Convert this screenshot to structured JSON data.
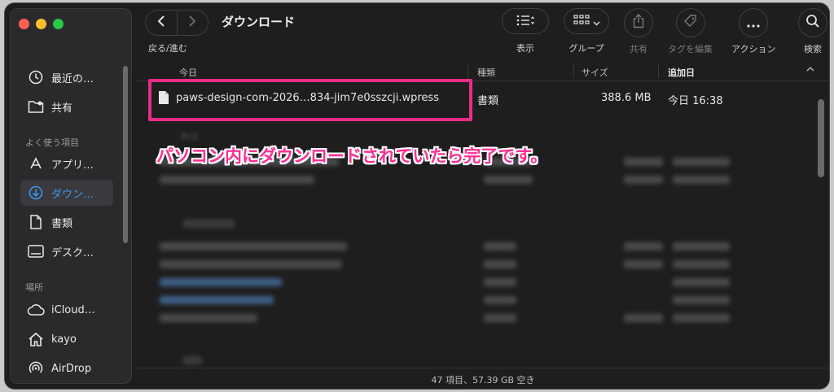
{
  "window": {
    "title": "ダウンロード"
  },
  "toolbar": {
    "nav_label": "戻る/進む",
    "view_label": "表示",
    "group_label": "グループ",
    "share_label": "共有",
    "tag_label": "タグを編集",
    "action_label": "アクション",
    "search_label": "検索"
  },
  "sidebar": {
    "items_top": [
      {
        "label": "最近の…",
        "icon": "clock-icon"
      },
      {
        "label": "共有",
        "icon": "shared-folder-icon"
      }
    ],
    "favorites_header": "よく使う項目",
    "favorites": [
      {
        "label": "アプリ…",
        "icon": "applications-icon"
      },
      {
        "label": "ダウン…",
        "icon": "downloads-icon"
      },
      {
        "label": "書類",
        "icon": "document-icon"
      },
      {
        "label": "デスク…",
        "icon": "desktop-icon"
      }
    ],
    "locations_header": "場所",
    "locations": [
      {
        "label": "iCloud…",
        "icon": "cloud-icon"
      },
      {
        "label": "kayo",
        "icon": "home-icon"
      },
      {
        "label": "AirDrop",
        "icon": "airdrop-icon"
      }
    ]
  },
  "columns": {
    "name": "今日",
    "kind": "種類",
    "size": "サイズ",
    "date": "追加日"
  },
  "file": {
    "name": "paws-design-com-2026…834-jim7e0sszcji.wpress",
    "kind": "書類",
    "size": "388.6 MB",
    "date": "今日 16:38"
  },
  "groups": {
    "yesterday": "昨日"
  },
  "annotation": "パソコン内にダウンロードされていたら完了です。",
  "status": "47 項目、57.39 GB 空き",
  "colors": {
    "accent": "#3b97f5",
    "highlight": "#ea2c88",
    "annotation": "#ff2e93"
  }
}
